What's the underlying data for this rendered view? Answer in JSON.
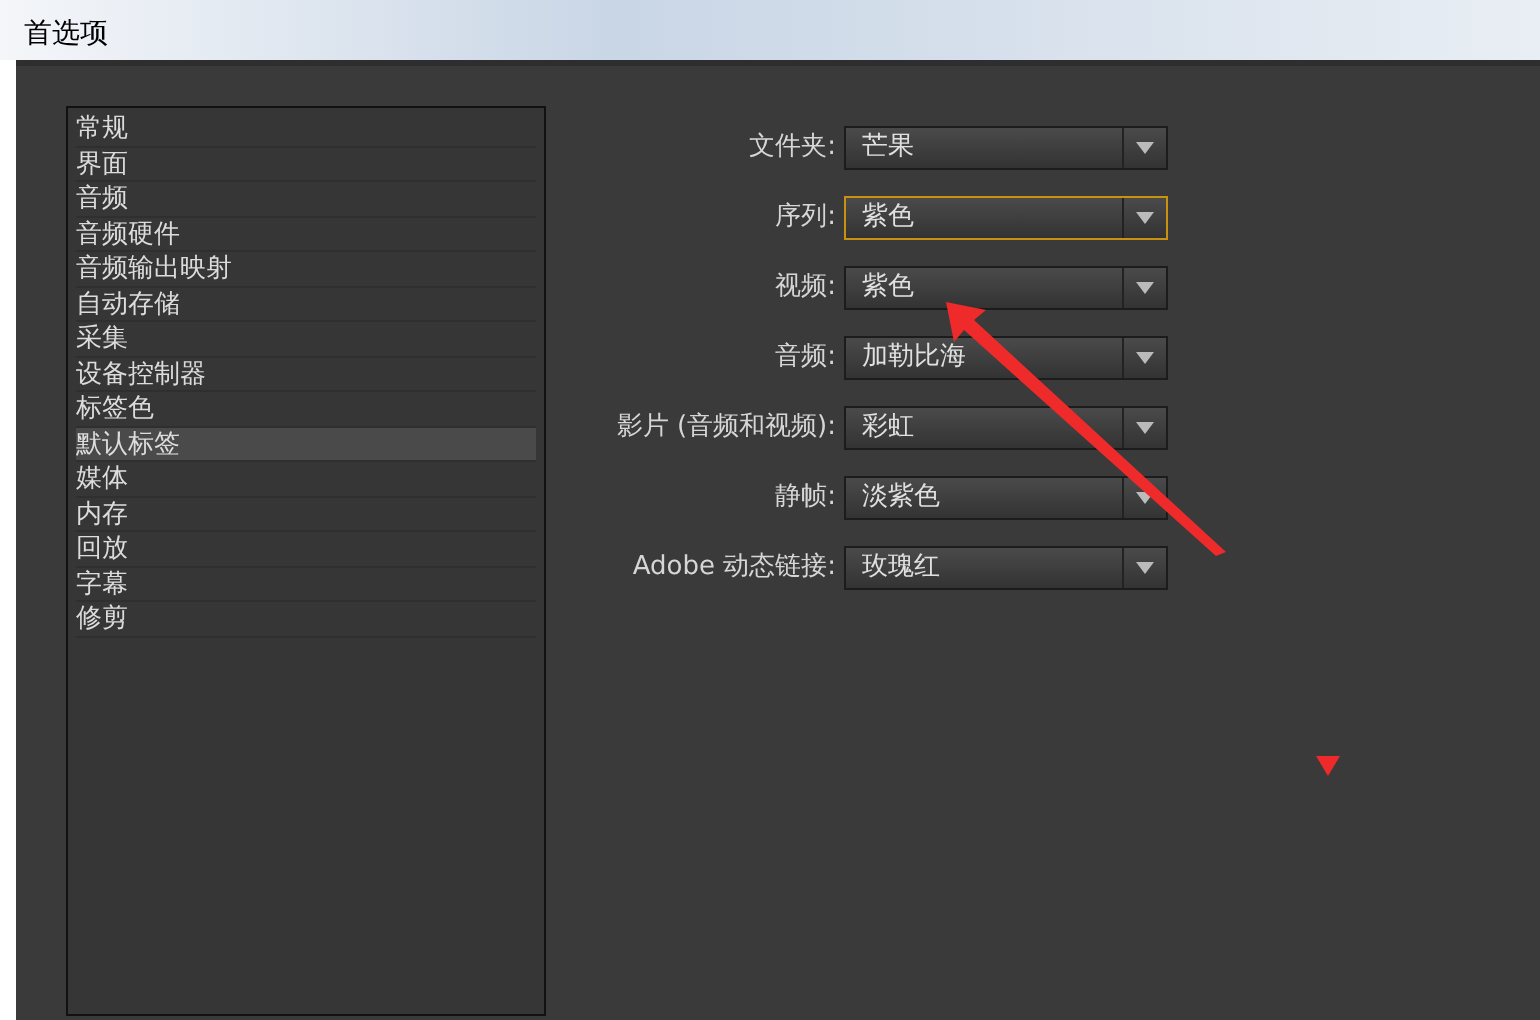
{
  "window": {
    "title": "首选项"
  },
  "sidebar": {
    "items": [
      {
        "label": "常规",
        "selected": false
      },
      {
        "label": "界面",
        "selected": false
      },
      {
        "label": "音频",
        "selected": false
      },
      {
        "label": "音频硬件",
        "selected": false
      },
      {
        "label": "音频输出映射",
        "selected": false
      },
      {
        "label": "自动存储",
        "selected": false
      },
      {
        "label": "采集",
        "selected": false
      },
      {
        "label": "设备控制器",
        "selected": false
      },
      {
        "label": "标签色",
        "selected": false
      },
      {
        "label": "默认标签",
        "selected": true
      },
      {
        "label": "媒体",
        "selected": false
      },
      {
        "label": "内存",
        "selected": false
      },
      {
        "label": "回放",
        "selected": false
      },
      {
        "label": "字幕",
        "selected": false
      },
      {
        "label": "修剪",
        "selected": false
      }
    ]
  },
  "fields": [
    {
      "label": "文件夹:",
      "value": "芒果",
      "focused": false
    },
    {
      "label": "序列:",
      "value": "紫色",
      "focused": true
    },
    {
      "label": "视频:",
      "value": "紫色",
      "focused": false
    },
    {
      "label": "音频:",
      "value": "加勒比海",
      "focused": false
    },
    {
      "label": "影片 (音频和视频):",
      "value": "彩虹",
      "focused": false
    },
    {
      "label": "静帧:",
      "value": "淡紫色",
      "focused": false
    },
    {
      "label": "Adobe 动态链接:",
      "value": "玫瑰红",
      "focused": false
    }
  ]
}
